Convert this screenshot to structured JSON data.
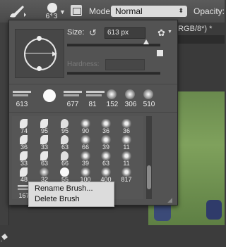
{
  "options_bar": {
    "brush_preset_size": "613",
    "mode_label": "Mode:",
    "mode_value": "Normal",
    "opacity_label": "Opacity:"
  },
  "document_tab": {
    "title": ", RGB/8*) *"
  },
  "brush_panel": {
    "size_label": "Size:",
    "size_value": "613 px",
    "size_fraction": 0.85,
    "hardness_label": "Hardness:",
    "hardness_value": "",
    "recent_brushes": [
      "613",
      "",
      "677",
      "81",
      "152",
      "306",
      "510"
    ],
    "grid_rows": [
      [
        "74",
        "95",
        "95",
        "90",
        "36",
        "36"
      ],
      [
        "36",
        "33",
        "63",
        "66",
        "39",
        "11"
      ],
      [
        "33",
        "63",
        "66",
        "39",
        "63",
        "11"
      ],
      [
        "48",
        "32",
        "55",
        "100",
        "400",
        "817"
      ],
      [
        "167",
        "",
        "",
        "",
        "",
        ""
      ]
    ]
  },
  "context_menu": {
    "items": [
      "Rename Brush...",
      "Delete Brush"
    ]
  },
  "colors": {
    "panel_bg": "#535353",
    "menu_bg": "#dcdcdc",
    "grass": "#7fa15c"
  }
}
